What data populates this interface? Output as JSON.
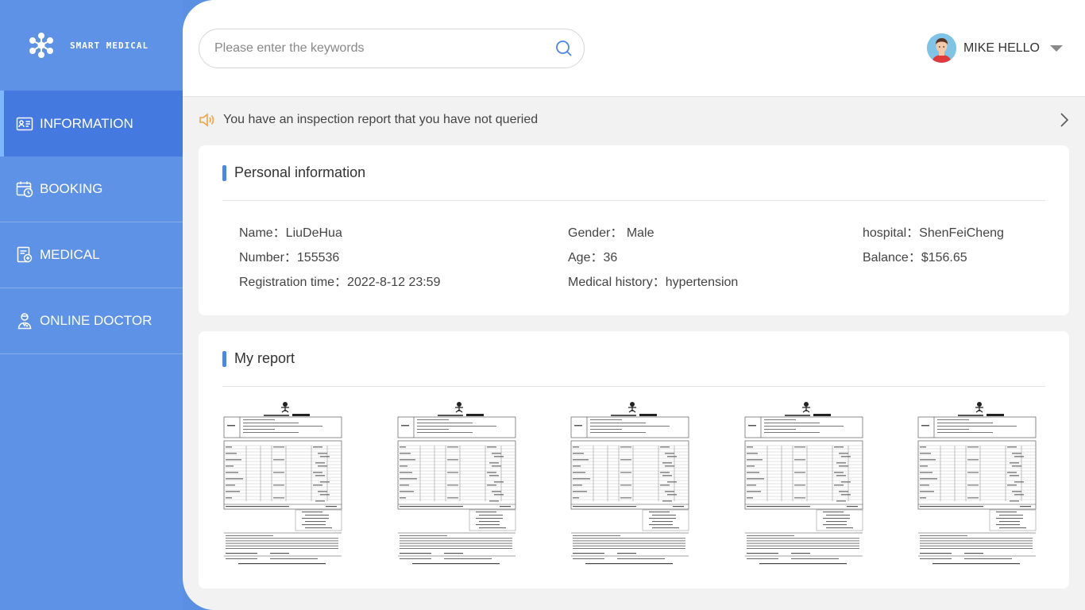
{
  "app": {
    "logo_text": "SMART MEDICAL"
  },
  "sidebar": {
    "items": [
      {
        "label": "INFORMATION",
        "icon": "id-card-icon",
        "active": true
      },
      {
        "label": "BOOKING",
        "icon": "calendar-clock-icon",
        "active": false
      },
      {
        "label": "MEDICAL",
        "icon": "medical-record-icon",
        "active": false
      },
      {
        "label": "ONLINE DOCTOR",
        "icon": "doctor-icon",
        "active": false
      }
    ]
  },
  "search": {
    "placeholder": "Please enter the keywords",
    "value": ""
  },
  "user": {
    "name": "MIKE HELLO"
  },
  "notice": {
    "text": "You have an inspection report that you have not queried"
  },
  "personal": {
    "title": "Personal information",
    "name": "Name：LiuDeHua",
    "gender": "Gender： Male",
    "hospital": "hospital：ShenFeiCheng",
    "number": "Number：155536",
    "age": "Age：36",
    "balance": "Balance：$156.65",
    "registration": "Registration time：2022-8-12 23:59",
    "history": "Medical history：hypertension"
  },
  "reports": {
    "title": "My report",
    "count": 5
  },
  "colors": {
    "sidebar": "#5e92e6",
    "sidebar_active": "#4479e0",
    "accent": "#4f86e4",
    "notice_icon": "#f0a347"
  }
}
